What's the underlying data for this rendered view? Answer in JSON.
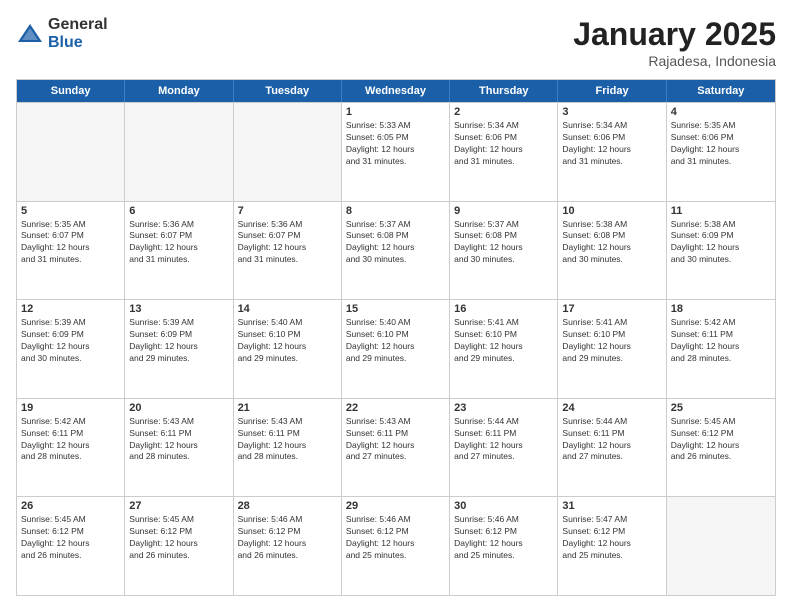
{
  "header": {
    "logo_general": "General",
    "logo_blue": "Blue",
    "month": "January 2025",
    "location": "Rajadesa, Indonesia"
  },
  "weekdays": [
    "Sunday",
    "Monday",
    "Tuesday",
    "Wednesday",
    "Thursday",
    "Friday",
    "Saturday"
  ],
  "rows": [
    [
      {
        "day": "",
        "info": "",
        "empty": true
      },
      {
        "day": "",
        "info": "",
        "empty": true
      },
      {
        "day": "",
        "info": "",
        "empty": true
      },
      {
        "day": "1",
        "info": "Sunrise: 5:33 AM\nSunset: 6:05 PM\nDaylight: 12 hours\nand 31 minutes."
      },
      {
        "day": "2",
        "info": "Sunrise: 5:34 AM\nSunset: 6:06 PM\nDaylight: 12 hours\nand 31 minutes."
      },
      {
        "day": "3",
        "info": "Sunrise: 5:34 AM\nSunset: 6:06 PM\nDaylight: 12 hours\nand 31 minutes."
      },
      {
        "day": "4",
        "info": "Sunrise: 5:35 AM\nSunset: 6:06 PM\nDaylight: 12 hours\nand 31 minutes."
      }
    ],
    [
      {
        "day": "5",
        "info": "Sunrise: 5:35 AM\nSunset: 6:07 PM\nDaylight: 12 hours\nand 31 minutes."
      },
      {
        "day": "6",
        "info": "Sunrise: 5:36 AM\nSunset: 6:07 PM\nDaylight: 12 hours\nand 31 minutes."
      },
      {
        "day": "7",
        "info": "Sunrise: 5:36 AM\nSunset: 6:07 PM\nDaylight: 12 hours\nand 31 minutes."
      },
      {
        "day": "8",
        "info": "Sunrise: 5:37 AM\nSunset: 6:08 PM\nDaylight: 12 hours\nand 30 minutes."
      },
      {
        "day": "9",
        "info": "Sunrise: 5:37 AM\nSunset: 6:08 PM\nDaylight: 12 hours\nand 30 minutes."
      },
      {
        "day": "10",
        "info": "Sunrise: 5:38 AM\nSunset: 6:08 PM\nDaylight: 12 hours\nand 30 minutes."
      },
      {
        "day": "11",
        "info": "Sunrise: 5:38 AM\nSunset: 6:09 PM\nDaylight: 12 hours\nand 30 minutes."
      }
    ],
    [
      {
        "day": "12",
        "info": "Sunrise: 5:39 AM\nSunset: 6:09 PM\nDaylight: 12 hours\nand 30 minutes."
      },
      {
        "day": "13",
        "info": "Sunrise: 5:39 AM\nSunset: 6:09 PM\nDaylight: 12 hours\nand 29 minutes."
      },
      {
        "day": "14",
        "info": "Sunrise: 5:40 AM\nSunset: 6:10 PM\nDaylight: 12 hours\nand 29 minutes."
      },
      {
        "day": "15",
        "info": "Sunrise: 5:40 AM\nSunset: 6:10 PM\nDaylight: 12 hours\nand 29 minutes."
      },
      {
        "day": "16",
        "info": "Sunrise: 5:41 AM\nSunset: 6:10 PM\nDaylight: 12 hours\nand 29 minutes."
      },
      {
        "day": "17",
        "info": "Sunrise: 5:41 AM\nSunset: 6:10 PM\nDaylight: 12 hours\nand 29 minutes."
      },
      {
        "day": "18",
        "info": "Sunrise: 5:42 AM\nSunset: 6:11 PM\nDaylight: 12 hours\nand 28 minutes."
      }
    ],
    [
      {
        "day": "19",
        "info": "Sunrise: 5:42 AM\nSunset: 6:11 PM\nDaylight: 12 hours\nand 28 minutes."
      },
      {
        "day": "20",
        "info": "Sunrise: 5:43 AM\nSunset: 6:11 PM\nDaylight: 12 hours\nand 28 minutes."
      },
      {
        "day": "21",
        "info": "Sunrise: 5:43 AM\nSunset: 6:11 PM\nDaylight: 12 hours\nand 28 minutes."
      },
      {
        "day": "22",
        "info": "Sunrise: 5:43 AM\nSunset: 6:11 PM\nDaylight: 12 hours\nand 27 minutes."
      },
      {
        "day": "23",
        "info": "Sunrise: 5:44 AM\nSunset: 6:11 PM\nDaylight: 12 hours\nand 27 minutes."
      },
      {
        "day": "24",
        "info": "Sunrise: 5:44 AM\nSunset: 6:11 PM\nDaylight: 12 hours\nand 27 minutes."
      },
      {
        "day": "25",
        "info": "Sunrise: 5:45 AM\nSunset: 6:12 PM\nDaylight: 12 hours\nand 26 minutes."
      }
    ],
    [
      {
        "day": "26",
        "info": "Sunrise: 5:45 AM\nSunset: 6:12 PM\nDaylight: 12 hours\nand 26 minutes."
      },
      {
        "day": "27",
        "info": "Sunrise: 5:45 AM\nSunset: 6:12 PM\nDaylight: 12 hours\nand 26 minutes."
      },
      {
        "day": "28",
        "info": "Sunrise: 5:46 AM\nSunset: 6:12 PM\nDaylight: 12 hours\nand 26 minutes."
      },
      {
        "day": "29",
        "info": "Sunrise: 5:46 AM\nSunset: 6:12 PM\nDaylight: 12 hours\nand 25 minutes."
      },
      {
        "day": "30",
        "info": "Sunrise: 5:46 AM\nSunset: 6:12 PM\nDaylight: 12 hours\nand 25 minutes."
      },
      {
        "day": "31",
        "info": "Sunrise: 5:47 AM\nSunset: 6:12 PM\nDaylight: 12 hours\nand 25 minutes."
      },
      {
        "day": "",
        "info": "",
        "empty": true
      }
    ]
  ]
}
